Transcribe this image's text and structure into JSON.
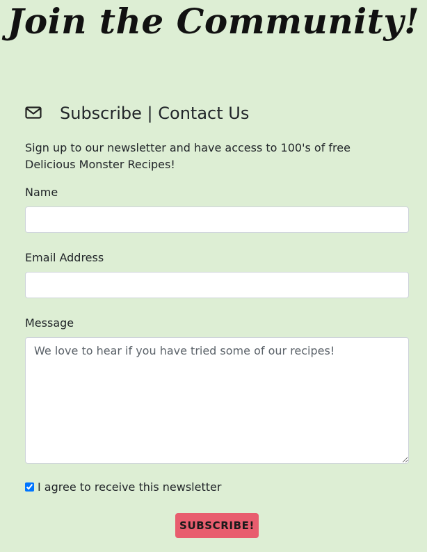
{
  "header": {
    "title": "Join the Community!"
  },
  "section": {
    "icon": "envelope-icon",
    "heading": "Subscribe | Contact Us",
    "intro": "Sign up to our newsletter and have access to 100's of free Delicious Monster Recipes!"
  },
  "form": {
    "name_label": "Name",
    "name_value": "",
    "email_label": "Email Address",
    "email_value": "",
    "message_label": "Message",
    "message_placeholder": "We love to hear if you have tried some of our recipes!",
    "message_value": "",
    "checkbox_label": "I agree to receive this newsletter",
    "checkbox_checked": true,
    "submit_label": "SUBSCRIBE!"
  },
  "colors": {
    "background": "#ddeed4",
    "button": "#e85d6e"
  }
}
